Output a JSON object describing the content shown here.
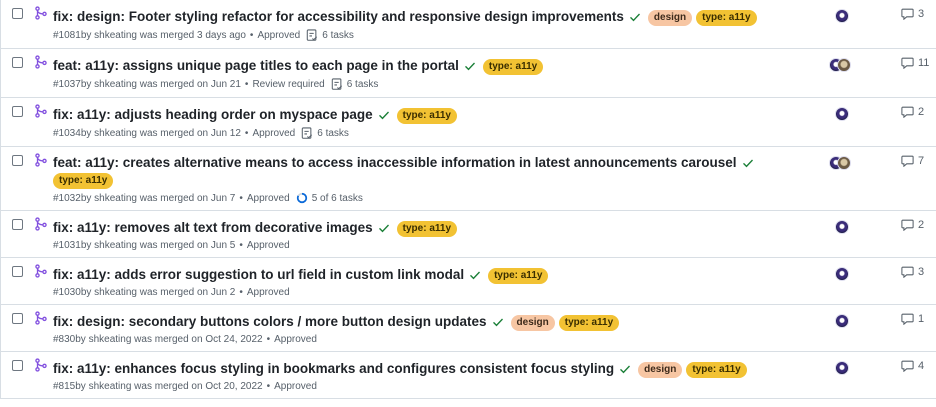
{
  "colors": {
    "merged_icon": "#8250df",
    "check": "#1a7f37",
    "label_design": "#f7c6a3",
    "label_a11y": "#f2c233"
  },
  "icons": {
    "merged": "git-merge-icon",
    "check": "check-icon",
    "tasks": "tasklist-icon",
    "progress": "progress-ring-icon",
    "comment": "comment-icon"
  },
  "pulls": [
    {
      "title": "fix: design: Footer styling refactor for accessibility and responsive design improvements",
      "labels": [
        "design",
        "type: a11y"
      ],
      "number": "#1081",
      "meta": "by shkeating was merged 3 days ago",
      "review": "Approved",
      "tasks": "6 tasks",
      "comments": "3",
      "avatars": 1
    },
    {
      "title": "feat: a11y: assigns unique page titles to each page in the portal",
      "labels": [
        "type: a11y"
      ],
      "number": "#1037",
      "meta": "by shkeating was merged on Jun 21",
      "review": "Review required",
      "tasks": "6 tasks",
      "comments": "11",
      "avatars": 2
    },
    {
      "title": "fix: a11y: adjusts heading order on myspace page",
      "labels": [
        "type: a11y"
      ],
      "number": "#1034",
      "meta": "by shkeating was merged on Jun 12",
      "review": "Approved",
      "tasks": "6 tasks",
      "comments": "2",
      "avatars": 1
    },
    {
      "title": "feat: a11y: creates alternative means to access inaccessible information in latest announcements carousel",
      "labels": [
        "type: a11y"
      ],
      "number": "#1032",
      "meta": "by shkeating was merged on Jun 7",
      "review": "Approved",
      "tasks": "5 of 6 tasks",
      "task_progress": 0.83,
      "comments": "7",
      "avatars": 2
    },
    {
      "title": "fix: a11y: removes alt text from decorative images",
      "labels": [
        "type: a11y"
      ],
      "number": "#1031",
      "meta": "by shkeating was merged on Jun 5",
      "review": "Approved",
      "comments": "2",
      "avatars": 1
    },
    {
      "title": "fix: a11y: adds error suggestion to url field in custom link modal",
      "labels": [
        "type: a11y"
      ],
      "number": "#1030",
      "meta": "by shkeating was merged on Jun 2",
      "review": "Approved",
      "comments": "3",
      "avatars": 1
    },
    {
      "title": "fix: design: secondary buttons colors / more button design updates",
      "labels": [
        "design",
        "type: a11y"
      ],
      "number": "#830",
      "meta": "by shkeating was merged on Oct 24, 2022",
      "review": "Approved",
      "comments": "1",
      "avatars": 1
    },
    {
      "title": "fix: a11y: enhances focus styling in bookmarks and configures consistent focus styling",
      "labels": [
        "design",
        "type: a11y"
      ],
      "number": "#815",
      "meta": "by shkeating was merged on Oct 20, 2022",
      "review": "Approved",
      "comments": "4",
      "avatars": 1
    }
  ]
}
